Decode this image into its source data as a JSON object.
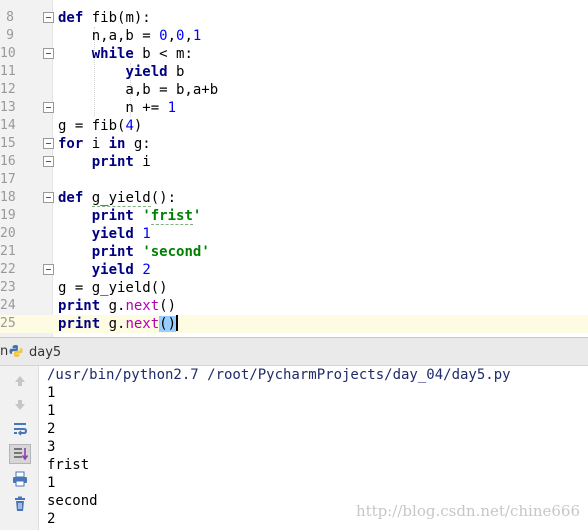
{
  "editor": {
    "line_numbers": [
      "8",
      "9",
      "10",
      "11",
      "12",
      "13",
      "14",
      "15",
      "16",
      "17",
      "18",
      "19",
      "20",
      "21",
      "22",
      "23",
      "24",
      "25"
    ],
    "current_line": "25"
  },
  "run_panel": {
    "tab_prefix": "n",
    "tab_label": "day5",
    "output": [
      "/usr/bin/python2.7 /root/PycharmProjects/day_04/day5.py",
      "1",
      "1",
      "2",
      "3",
      "frist",
      "1",
      "second",
      "2"
    ],
    "toolbar_icons": [
      "up-arrow-icon",
      "down-arrow-icon",
      "soft-wrap-icon",
      "scroll-to-end-icon",
      "print-icon",
      "trash-icon"
    ]
  },
  "watermark": "http://blog.csdn.net/chine666",
  "colors": {
    "keyword": "#000080",
    "number": "#0000ff",
    "string": "#008000",
    "method": "#b200b2",
    "selection": "#99ccff"
  }
}
